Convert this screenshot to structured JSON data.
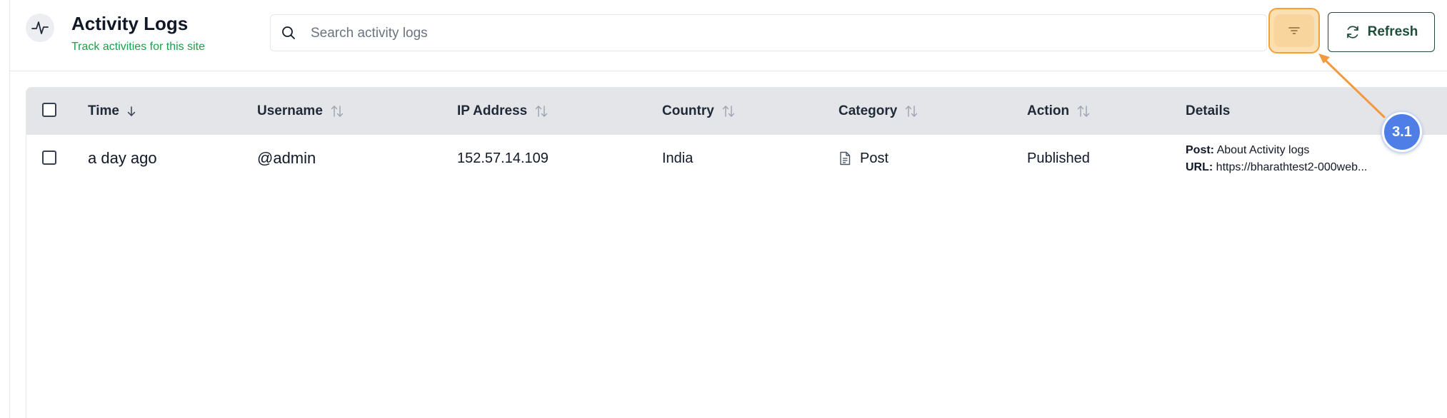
{
  "header": {
    "title": "Activity Logs",
    "subtitle": "Track activities for this site",
    "logo_icon": "activity-pulse-icon",
    "search": {
      "placeholder": "Search activity logs",
      "value": ""
    },
    "filter_icon": "filter-icon",
    "refresh_label": "Refresh",
    "refresh_icon": "refresh-icon"
  },
  "table": {
    "columns": [
      {
        "label": "Time",
        "sort": "desc"
      },
      {
        "label": "Username",
        "sort": "none"
      },
      {
        "label": "IP Address",
        "sort": "none"
      },
      {
        "label": "Country",
        "sort": "none"
      },
      {
        "label": "Category",
        "sort": "none"
      },
      {
        "label": "Action",
        "sort": "none"
      },
      {
        "label": "Details",
        "sort": ""
      }
    ],
    "rows": [
      {
        "time": "a day ago",
        "username": "@admin",
        "ip": "152.57.14.109",
        "country": "India",
        "category": "Post",
        "category_icon": "document-icon",
        "action": "Published",
        "details": {
          "post_label": "Post:",
          "post_value": "About Activity logs",
          "url_label": "URL:",
          "url_value": "https://bharathtest2-000web..."
        }
      }
    ]
  },
  "annotation": {
    "label": "3.1",
    "color": "#4f7fe6",
    "arrow_color": "#f29a3c"
  },
  "colors": {
    "accent_green": "#16a34a",
    "refresh_border": "#1f4d3a",
    "filter_highlight": "#fbe0b4",
    "header_bg": "#e4e5e8"
  }
}
